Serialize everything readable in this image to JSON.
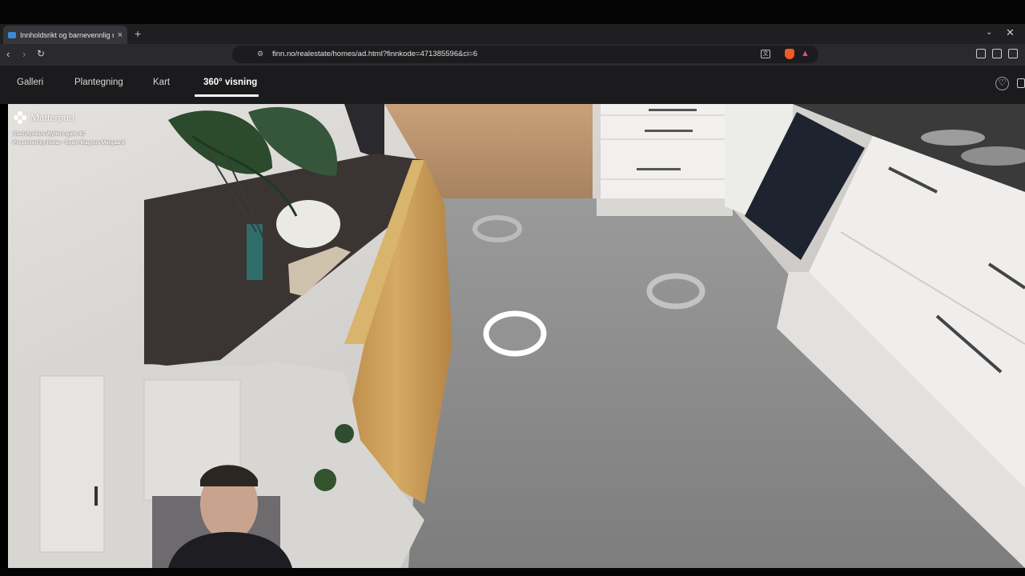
{
  "browser": {
    "tab_title": "Innholdsrikt og barnevennlig rek",
    "tab_close": "×",
    "new_tab": "+",
    "url": "finn.no/realestate/homes/ad.html?finnkode=471385596&ci=6"
  },
  "site_nav": {
    "tabs": [
      {
        "label": "Galleri"
      },
      {
        "label": "Plantegning"
      },
      {
        "label": "Kart"
      },
      {
        "label": "360° visning"
      }
    ],
    "active_tab": "360° visning"
  },
  "viewer": {
    "brand": "Matterport",
    "address": "Stadsfysikus Wyllers gate 4C",
    "presenter": "Presented by Notar - Svein Magnus Melgaard"
  },
  "colors": {
    "page_bg": "#1b1b1d",
    "active_underline": "#ffffff",
    "cabinet_white": "#eeeeec",
    "floor_grey": "#8c8c8c",
    "oak_front": "#c99a55"
  },
  "icons": [
    "back-icon",
    "forward-icon",
    "reload-icon",
    "bookmark-icon",
    "site-settings-icon",
    "translate-icon",
    "brave-shield-icon",
    "brave-rewards-icon",
    "extensions-icon",
    "sidebar-icon",
    "wallet-icon",
    "heart-icon",
    "share-icon",
    "matterport-logo-icon"
  ]
}
